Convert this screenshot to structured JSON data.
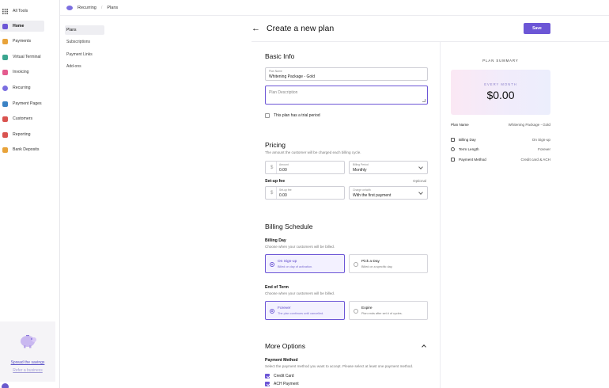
{
  "sidebar": {
    "items": [
      {
        "label": "All Tools",
        "color": "#444444"
      },
      {
        "label": "Home",
        "color": "#6c56d6"
      },
      {
        "label": "Payments",
        "color": "#e8a33a"
      },
      {
        "label": "Virtual Terminal",
        "color": "#3aa58f"
      },
      {
        "label": "Invoicing",
        "color": "#e45b8e"
      },
      {
        "label": "Recurring",
        "color": "#7b6ee0"
      },
      {
        "label": "Payment Pages",
        "color": "#3b82c4"
      },
      {
        "label": "Customers",
        "color": "#d9534f"
      },
      {
        "label": "Reporting",
        "color": "#d9534f"
      },
      {
        "label": "Bank Deposits",
        "color": "#e8a33a"
      }
    ],
    "promo": {
      "link1": "Spread the savings",
      "link2": "Refer a business"
    }
  },
  "topbar": {
    "section": "Recurring",
    "page": "Plans"
  },
  "subnav": {
    "items": [
      "Plans",
      "Subscriptions",
      "Payment Links",
      "Add-ons"
    ]
  },
  "header": {
    "title": "Create a new plan",
    "save_label": "Save"
  },
  "basic_info": {
    "title": "Basic Info",
    "plan_name_label": "Plan Name",
    "plan_name_value": "Whitening Package - Gold",
    "plan_description_placeholder": "Plan Description",
    "trial_label": "This plan has a trial period"
  },
  "pricing": {
    "title": "Pricing",
    "helper": "The amount the customer will be charged each billing cycle.",
    "amount_label": "Amount",
    "amount_value": "0.00",
    "billing_period_label": "Billing Period",
    "billing_period_value": "Monthly",
    "setup_fee_title": "Set-up fee",
    "optional_label": "Optional",
    "setup_fee_label": "Set-up fee",
    "setup_fee_value": "0.00",
    "charge_label": "Charge on/with",
    "charge_value": "With the first payment",
    "currency_symbol": "$"
  },
  "billing_schedule": {
    "title": "Billing Schedule",
    "billing_day_title": "Billing Day",
    "billing_day_helper": "Choose when your customers will be billed.",
    "billing_day_options": [
      {
        "title": "On Sign-up",
        "sub": "Billed on day of activation."
      },
      {
        "title": "Pick a Day",
        "sub": "Billed on a specific day."
      }
    ],
    "end_of_term_title": "End of Term",
    "end_of_term_helper": "Choose when your customers will be billed.",
    "end_of_term_options": [
      {
        "title": "Forever",
        "sub": "The plan continues until cancelled."
      },
      {
        "title": "Expire",
        "sub": "Plan ends after set # of cycles."
      }
    ]
  },
  "more_options": {
    "title": "More Options",
    "payment_method_title": "Payment Method",
    "payment_method_helper": "Select the payment method you want to accept. Please select at least one payment method.",
    "methods": [
      "Credit Card",
      "ACH Payment"
    ]
  },
  "summary": {
    "label": "PLAN SUMMARY",
    "every": "EVERY MONTH",
    "amount": "$0.00",
    "plan_name_key": "Plan Name",
    "plan_name_value": "Whitening Package - Gold",
    "rows": [
      {
        "key": "Billing Day",
        "value": "On Sign-up"
      },
      {
        "key": "Term Length",
        "value": "Forever"
      },
      {
        "key": "Payment Method",
        "value": "Credit card & ACH"
      }
    ]
  },
  "colors": {
    "accent": "#6c56d6"
  }
}
